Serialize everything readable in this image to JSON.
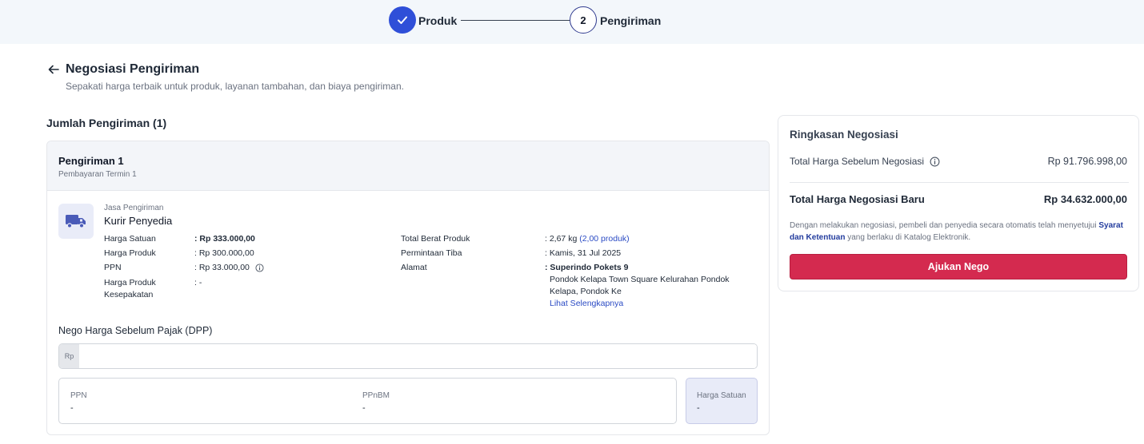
{
  "stepper": {
    "step1_label": "Produk",
    "step2_number": "2",
    "step2_label": "Pengiriman"
  },
  "header": {
    "title": "Negosiasi Pengiriman",
    "subtitle": "Sepakati harga terbaik untuk produk, layanan tambahan, dan biaya pengiriman."
  },
  "section_title": "Jumlah Pengiriman (1)",
  "shipment": {
    "title": "Pengiriman 1",
    "subtitle": "Pembayaran Termin 1",
    "service_label": "Jasa Pengiriman",
    "service_value": "Kurir Penyedia",
    "left_details": [
      {
        "key": "Harga Satuan",
        "value": ": Rp 333.000,00"
      },
      {
        "key": "Harga Produk",
        "value": ": Rp 300.000,00"
      },
      {
        "key": "PPN",
        "value": ": Rp 33.000,00"
      },
      {
        "key": "Harga Produk Kesepakatan",
        "value": ": -"
      }
    ],
    "right_details": {
      "weight_key": "Total Berat Produk",
      "weight_value": ": 2,67 kg",
      "weight_link": "(2,00 produk)",
      "arrival_key": "Permintaan Tiba",
      "arrival_value": ": Kamis, 31 Jul 2025",
      "address_key": "Alamat",
      "address_name": ": Superindo Pokets 9",
      "address_line": "Pondok Kelapa Town Square Kelurahan Pondok Kelapa, Pondok Ke",
      "address_link": "Lihat Selengkapnya"
    }
  },
  "nego": {
    "label": "Nego Harga Sebelum Pajak (DPP)",
    "currency_prefix": "Rp",
    "input_value": "",
    "ppn_label": "PPN",
    "ppn_value": "-",
    "ppnbm_label": "PPnBM",
    "ppnbm_value": "-",
    "unit_price_label": "Harga Satuan",
    "unit_price_value": "-"
  },
  "summary": {
    "title": "Ringkasan Negosiasi",
    "before_label": "Total Harga Sebelum Negosiasi",
    "before_value": "Rp 91.796.998,00",
    "new_label": "Total Harga Negosiasi Baru",
    "new_value": "Rp 34.632.000,00",
    "note_prefix": "Dengan melakukan negosiasi, pembeli dan penyedia secara otomatis telah menyetujui",
    "note_link": "Syarat dan Ketentuan",
    "note_suffix": "yang berlaku di Katalog Elektronik.",
    "button_label": "Ajukan Nego"
  },
  "colors": {
    "accent_blue": "#2f4fd8",
    "link_blue": "#2b4bc4",
    "button_red": "#d42a4f"
  }
}
